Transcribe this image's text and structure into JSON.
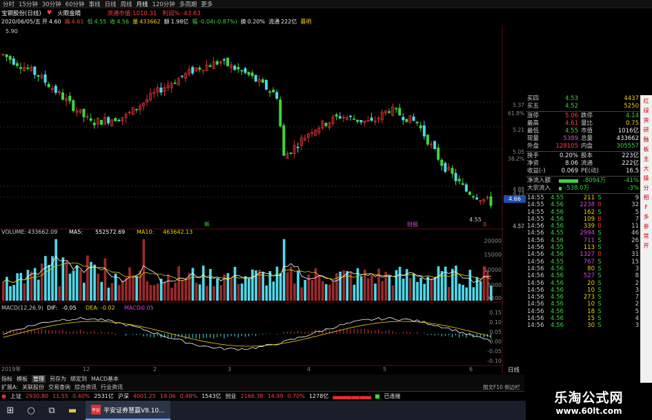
{
  "toolbar": {
    "items": [
      "分时",
      "15分钟",
      "30分钟",
      "60分钟",
      "事线",
      "日线",
      "周线",
      "月线",
      "120分钟",
      "多周期",
      "更多"
    ],
    "active": "月线"
  },
  "header": {
    "stock_label": "宝钢股份(日线)",
    "fav_icon": "heart-icon",
    "fav_label": "火眼金睛",
    "market_cap_label": "流通市值:",
    "market_cap_value": "1010.31",
    "profit_label": "利润%:",
    "profit_value": "-43.63"
  },
  "ohlc": {
    "date": "2020/06/05/五",
    "open_label": "开",
    "open": "4.60",
    "high_label": "高",
    "high": "4.61",
    "low_label": "低",
    "low": "4.55",
    "close_label": "收",
    "close": "4.56",
    "vol_label": "量",
    "vol": "433662",
    "amt_label": "额",
    "amt": "1.98亿",
    "chg_label": "幅",
    "chg": "-0.04(-0.87%)",
    "turn_label": "换",
    "turn": "0.20%",
    "float_label": "流通",
    "float": "222亿",
    "status": "暮明"
  },
  "price_axis": {
    "ticks": [
      "5.37",
      "61.8%",
      "5.21",
      "5.05",
      "38.2%",
      "4.89",
      "4.73",
      "19.1%",
      "4.66",
      "4.57",
      "4.52"
    ],
    "current": "4.66",
    "high_marker": "5.90",
    "low_marker": "4.55"
  },
  "chart_markers": {
    "xin": "新",
    "cai": "财报",
    "bottom_mark": "B"
  },
  "volume": {
    "label": "VOLUME:",
    "value": "433662.09",
    "ma5_label": "MA5:",
    "ma5": "552572.69",
    "ma10_label": "MA10:",
    "ma10": "463642.13",
    "axis": [
      "20000",
      "15000",
      "10000",
      "5000",
      "X100"
    ]
  },
  "macd": {
    "label": "MACD(12,26,9)",
    "dif_label": "DIF:",
    "dif": "-0.05",
    "dea_label": "DEA:",
    "dea": "-0.02",
    "macd_label": "MACD:",
    "macd": "-0.05",
    "axis": [
      "0.15",
      "0.10",
      "0.05",
      "0.00",
      "-0.05",
      "-0.10"
    ]
  },
  "time_axis": {
    "labels": [
      "2019年",
      "12",
      "2",
      "3",
      "4",
      "5",
      "6"
    ],
    "format": "日线"
  },
  "quotes": {
    "bids": [
      {
        "label": "买四",
        "price": "4.53",
        "vol": "4437"
      },
      {
        "label": "买五",
        "price": "4.52",
        "vol": "5250"
      }
    ],
    "stats": [
      {
        "l1": "涨停",
        "v1": "5.06",
        "l2": "跌停",
        "v2": "4.14",
        "c1": "red",
        "c2": "green"
      },
      {
        "l1": "最高",
        "v1": "4.61",
        "l2": "量比",
        "v2": "0.75",
        "c1": "red",
        "c2": "yellow"
      },
      {
        "l1": "最低",
        "v1": "4.55",
        "l2": "市值",
        "v2": "1016亿",
        "c1": "green",
        "c2": "white"
      },
      {
        "l1": "现量",
        "v1": "5389",
        "l2": "总量",
        "v2": "433662",
        "c1": "magenta",
        "c2": "white"
      },
      {
        "l1": "外盘",
        "v1": "128105",
        "l2": "内盘",
        "v2": "305557",
        "c1": "red",
        "c2": "green"
      }
    ],
    "stats2": [
      {
        "l1": "换手",
        "v1": "0.20%",
        "l2": "股本",
        "v2": "223亿"
      },
      {
        "l1": "净资",
        "v1": "8.06",
        "l2": "流通",
        "v2": "222亿"
      },
      {
        "l1": "收益(-)",
        "v1": "0.069",
        "l2": "PE(动)",
        "v2": "16.5"
      }
    ],
    "flows": [
      {
        "label": "净流入额",
        "value": "-8094万",
        "pct": "-41%"
      },
      {
        "label": "大宗流入",
        "value": "-538.0万",
        "pct": "-3%"
      }
    ]
  },
  "ticks": [
    {
      "t": "14:55",
      "p": "4.55",
      "v": "211",
      "bs": "S",
      "n": "9"
    },
    {
      "t": "14:55",
      "p": "4.56",
      "v": "2238",
      "bs": "B",
      "n": "32"
    },
    {
      "t": "14:55",
      "p": "4.56",
      "v": "162",
      "bs": "S",
      "n": "5"
    },
    {
      "t": "14:55",
      "p": "4.56",
      "v": "109",
      "bs": "B",
      "n": "7"
    },
    {
      "t": "14:56",
      "p": "4.56",
      "v": "339",
      "bs": "B",
      "n": "11"
    },
    {
      "t": "14:56",
      "p": "4.55",
      "v": "2994",
      "bs": "S",
      "n": "46"
    },
    {
      "t": "14:56",
      "p": "4.56",
      "v": "711",
      "bs": "S",
      "n": "26"
    },
    {
      "t": "14:56",
      "p": "4.55",
      "v": "113",
      "bs": "S",
      "n": "5"
    },
    {
      "t": "14:56",
      "p": "4.56",
      "v": "1327",
      "bs": "B",
      "n": "31"
    },
    {
      "t": "14:56",
      "p": "4.55",
      "v": "767",
      "bs": "S",
      "n": "15"
    },
    {
      "t": "14:56",
      "p": "4.56",
      "v": "80",
      "bs": "S",
      "n": "3"
    },
    {
      "t": "14:56",
      "p": "4.56",
      "v": "527",
      "bs": "S",
      "n": "8"
    },
    {
      "t": "14:56",
      "p": "4.56",
      "v": "20",
      "bs": "S",
      "n": "2"
    },
    {
      "t": "14:56",
      "p": "4.56",
      "v": "10",
      "bs": "S",
      "n": "3"
    },
    {
      "t": "14:56",
      "p": "4.56",
      "v": "273",
      "bs": "S",
      "n": "7"
    },
    {
      "t": "14:56",
      "p": "4.56",
      "v": "10",
      "bs": "S",
      "n": "2"
    },
    {
      "t": "14:56",
      "p": "4.56",
      "v": "18",
      "bs": "S",
      "n": "5"
    },
    {
      "t": "14:56",
      "p": "4.56",
      "v": "15",
      "bs": "S",
      "n": "4"
    },
    {
      "t": "14:56",
      "p": "4.56",
      "v": "30",
      "bs": "S",
      "n": "3"
    }
  ],
  "sidebar": [
    "红",
    "绿",
    "资",
    "研",
    "融",
    "板",
    "主",
    "大",
    "操",
    "分",
    "相",
    "F",
    "多",
    "参",
    "常",
    "开"
  ],
  "bottom_tabs": {
    "row1": [
      "指标",
      "模板",
      "管理",
      "另存为",
      "绑定到",
      "MACD基本"
    ],
    "row1_active": "管理",
    "row2": [
      "扩展A:",
      "关联股份",
      "交易查询",
      "综合资讯",
      "行业资讯"
    ],
    "f10": "图文F10 侧边栏"
  },
  "statusbar": {
    "items": [
      {
        "name": "上证",
        "value": "2930.80",
        "chg": "11.55",
        "pct": "0.40%",
        "vol": "2531亿"
      },
      {
        "name": "沪深",
        "value": "4001.25",
        "chg": "19.06",
        "pct": "0.48%",
        "vol": "1543亿"
      },
      {
        "name": "创业",
        "value": "2166.38",
        "chg": "14.99",
        "pct": "0.70%",
        "vol": "1278亿"
      }
    ],
    "conn": "已连接"
  },
  "taskbar": {
    "app_label": "平安证券慧赢V8.10...",
    "app_icon_text": "平安"
  },
  "watermark": {
    "line1": "乐淘公式网",
    "line2": "www.60lt.com"
  },
  "colors": {
    "up": "#e03030",
    "down": "#3cd63c",
    "flat_cyan": "#4fd8e8",
    "yellow": "#f0d000",
    "magenta": "#e040e0"
  }
}
